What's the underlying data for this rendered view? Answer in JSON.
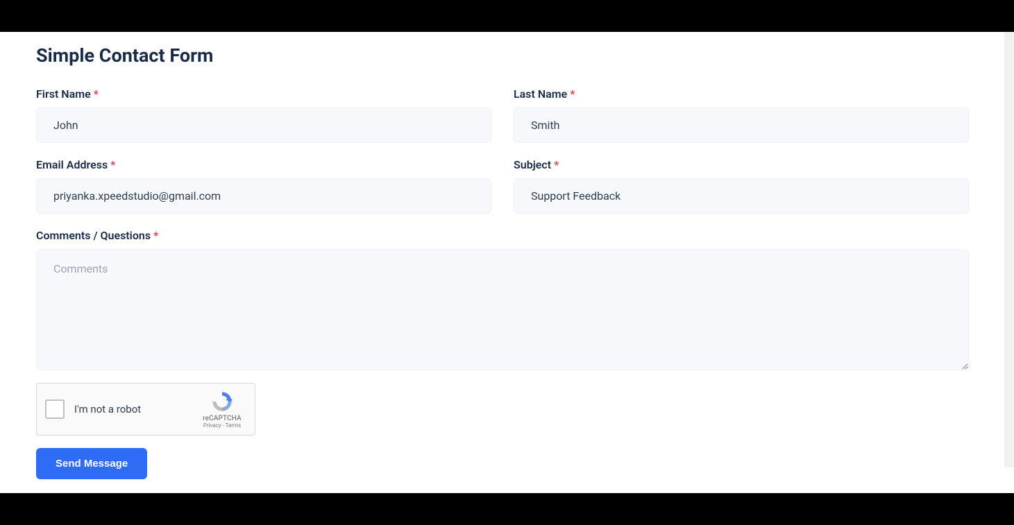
{
  "page": {
    "title": "Simple Contact Form"
  },
  "form": {
    "first_name": {
      "label": "First Name",
      "value": "John"
    },
    "last_name": {
      "label": "Last Name",
      "value": "Smith"
    },
    "email": {
      "label": "Email Address",
      "value": "priyanka.xpeedstudio@gmail.com"
    },
    "subject": {
      "label": "Subject",
      "value": "Support Feedback"
    },
    "comments": {
      "label": "Comments / Questions",
      "placeholder": "Comments",
      "value": ""
    }
  },
  "recaptcha": {
    "label": "I'm not a robot",
    "brand": "reCAPTCHA",
    "links": "Privacy - Terms"
  },
  "submit": {
    "label": "Send Message"
  }
}
